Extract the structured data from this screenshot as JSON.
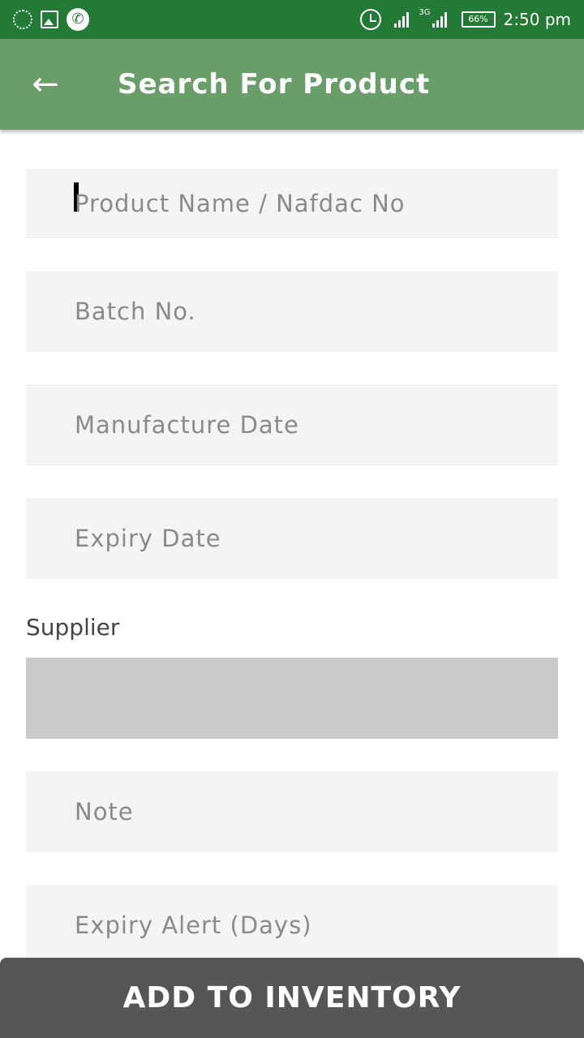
{
  "status_bar": {
    "network_type": "3G",
    "battery": "66%",
    "time": "2:50 pm",
    "icons": [
      "loader-icon",
      "image-icon",
      "phone-icon",
      "alarm-icon",
      "signal-icon",
      "signal-icon",
      "battery-icon"
    ]
  },
  "app_bar": {
    "back_icon": "←",
    "title": "Search For Product"
  },
  "form": {
    "product_placeholder": "Product Name / Nafdac No",
    "batch_placeholder": "Batch No.",
    "manufacture_placeholder": "Manufacture Date",
    "expiry_placeholder": "Expiry Date",
    "supplier_label": "Supplier",
    "supplier_value": "",
    "note_placeholder": "Note",
    "expiry_alert_placeholder": "Expiry Alert (Days)"
  },
  "actions": {
    "add_label": "ADD TO INVENTORY"
  },
  "colors": {
    "status_bar": "#237a35",
    "app_bar": "#699e69",
    "field_bg": "#f4f4f4",
    "supplier_bg": "#c9c9c9",
    "button_bg": "#565656"
  }
}
